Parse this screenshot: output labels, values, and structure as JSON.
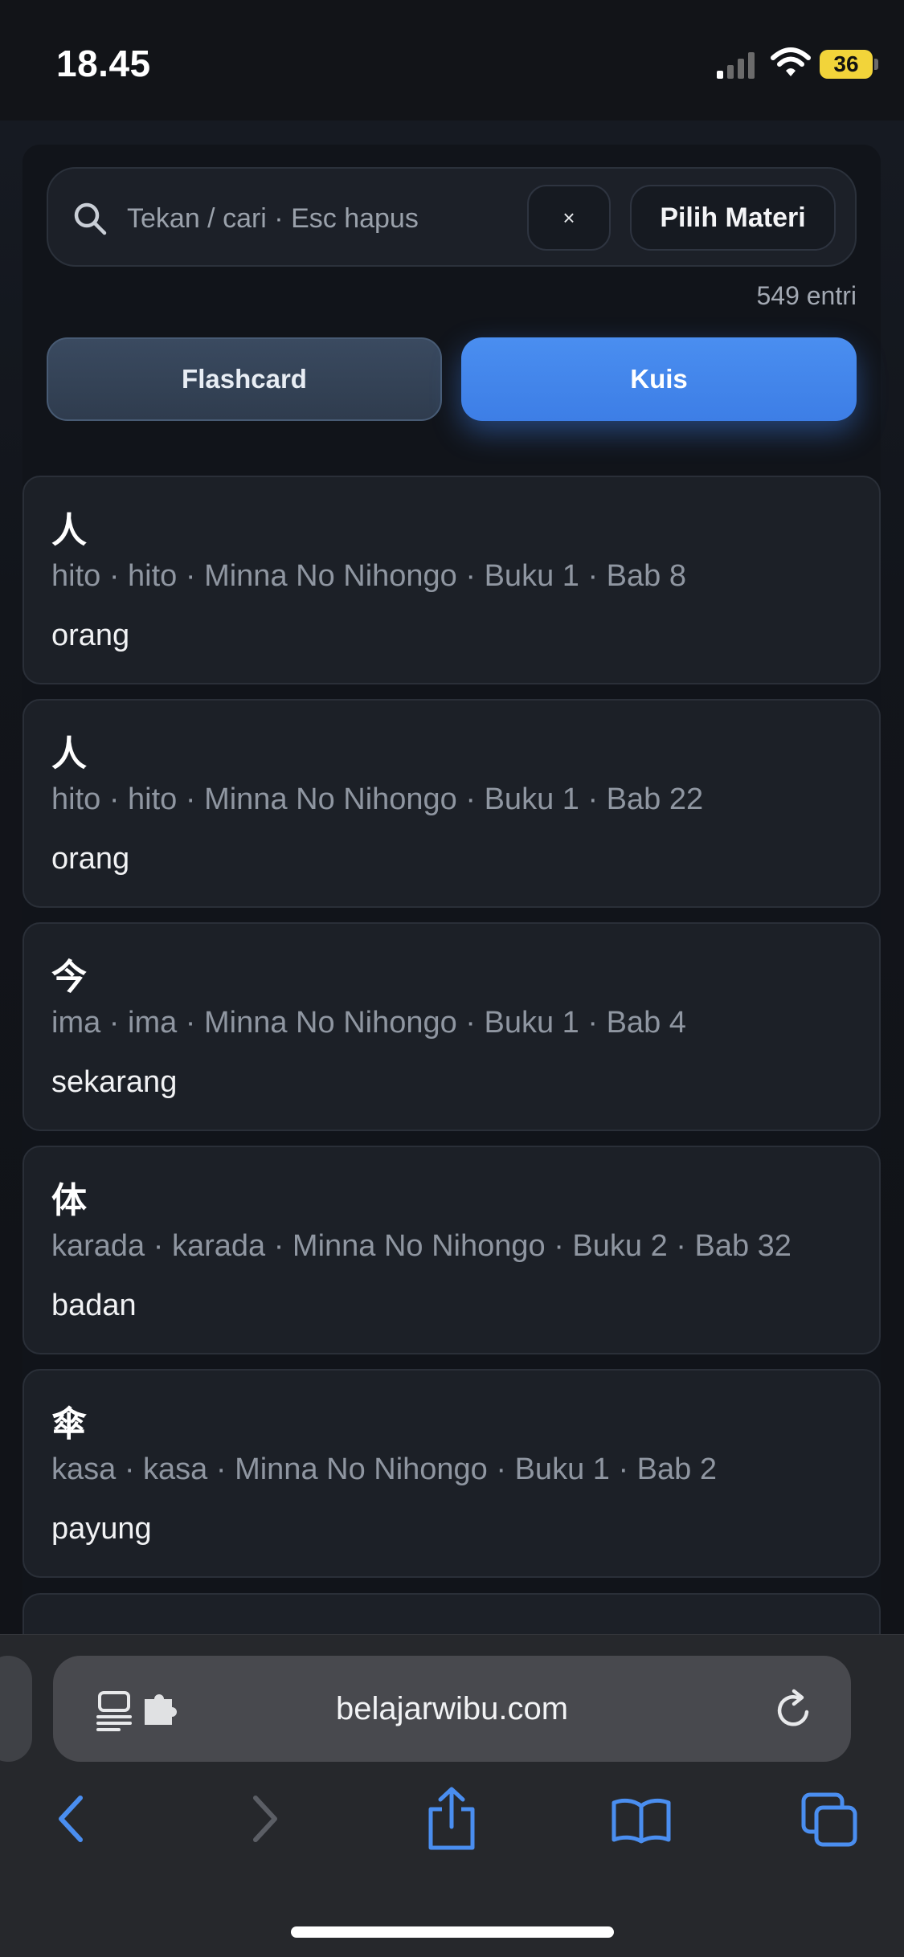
{
  "status_bar": {
    "time": "18.45",
    "battery": "36",
    "battery_color": "#f2d43a"
  },
  "search": {
    "placeholder": "Tekan / cari · Esc hapus",
    "value": "",
    "clear_label": "×",
    "select_material_label": "Pilih Materi",
    "entry_count": "549 entri"
  },
  "modes": {
    "flashcard_label": "Flashcard",
    "quiz_label": "Kuis",
    "active": "Kuis",
    "accent_color": "#4a8ef0"
  },
  "entries": [
    {
      "kanji": "人",
      "meta": "hito · hito · Minna No Nihongo · Buku 1 · Bab 8",
      "meaning": "orang"
    },
    {
      "kanji": "人",
      "meta": "hito · hito · Minna No Nihongo · Buku 1 · Bab 22",
      "meaning": "orang"
    },
    {
      "kanji": "今",
      "meta": "ima · ima · Minna No Nihongo · Buku 1 · Bab 4",
      "meaning": "sekarang"
    },
    {
      "kanji": "体",
      "meta": "karada · karada · Minna No Nihongo · Buku 2 · Bab 32",
      "meaning": "badan"
    },
    {
      "kanji": "傘",
      "meta": "kasa · kasa · Minna No Nihongo · Buku 1 · Bab 2",
      "meaning": "payung"
    }
  ],
  "browser": {
    "url": "belajarwibu.com",
    "icons": [
      "reader-icon",
      "extension-icon",
      "reload-icon",
      "back-icon",
      "forward-icon",
      "share-icon",
      "bookmarks-icon",
      "tabs-icon"
    ]
  }
}
